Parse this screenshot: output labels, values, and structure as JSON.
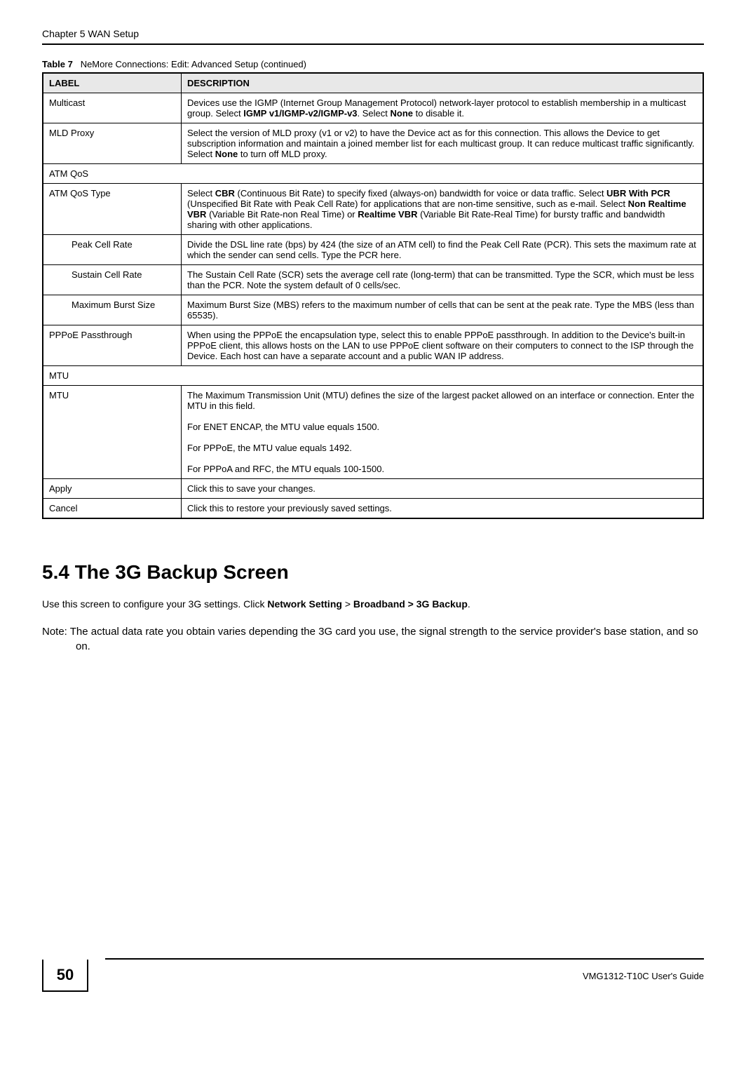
{
  "header": {
    "chapter": "Chapter 5 WAN Setup"
  },
  "table": {
    "caption_prefix": "Table 7",
    "caption_rest": "NeMore Connections: Edit: Advanced Setup (continued)",
    "head_label": "LABEL",
    "head_desc": "DESCRIPTION",
    "rows": {
      "multicast": {
        "label": "Multicast",
        "desc_pre": "Devices use the IGMP (Internet Group Management Protocol) network-layer protocol to establish membership in a multicast group. Select ",
        "b1": "IGMP v1/IGMP-v2/IGMP-v3",
        "desc_mid": ". Select ",
        "b2": "None",
        "desc_post": " to disable it."
      },
      "mld": {
        "label": "MLD Proxy",
        "desc_pre": "Select the version of MLD proxy (v1 or v2) to have the Device act as for this connection. This allows the Device to get subscription information and maintain a joined member list for each multicast group. It can reduce multicast traffic significantly. Select ",
        "b1": "None",
        "desc_post": " to turn off MLD proxy."
      },
      "atmqos_section": "ATM QoS",
      "atmqostype": {
        "label": "ATM QoS Type",
        "t1": "Select ",
        "b1": "CBR",
        "t2": " (Continuous Bit Rate) to specify fixed (always-on) bandwidth for voice or data traffic. Select ",
        "b2": "UBR With PCR",
        "t3": " (Unspecified Bit Rate with Peak Cell Rate) for applications that are non-time sensitive, such as e-mail. Select ",
        "b3": "Non Realtime VBR",
        "t4": " (Variable Bit Rate-non Real Time) or ",
        "b4": "Realtime VBR",
        "t5": " (Variable Bit Rate-Real Time) for bursty traffic and bandwidth sharing with other applications."
      },
      "pcr": {
        "label": "Peak Cell Rate",
        "desc": "Divide the DSL line rate (bps) by 424 (the size of an ATM cell) to find the Peak Cell Rate (PCR). This sets the maximum rate at which the sender can send cells. Type the PCR here."
      },
      "scr": {
        "label": "Sustain Cell Rate",
        "desc": "The Sustain Cell Rate (SCR) sets the average cell rate (long-term) that can be transmitted. Type the SCR, which must be less than the PCR. Note the system default of 0 cells/sec."
      },
      "mbs": {
        "label": "Maximum Burst Size",
        "desc": "Maximum Burst Size (MBS) refers to the maximum number of cells that can be sent at the peak rate. Type the MBS (less than 65535)."
      },
      "pppoe": {
        "label": "PPPoE Passthrough",
        "desc": "When using the PPPoE the encapsulation type, select this to enable PPPoE passthrough. In addition to the Device's built-in PPPoE client, this allows hosts on the LAN to use PPPoE client software on their computers to connect to the ISP through the Device. Each host can have a separate account and a public WAN IP address."
      },
      "mtu_section": "MTU",
      "mtu": {
        "label": "MTU",
        "p1": "The Maximum Transmission Unit (MTU) defines the size of the largest packet allowed on an interface or connection. Enter the MTU in this field.",
        "p2": "For ENET ENCAP, the MTU value equals 1500.",
        "p3": "For PPPoE, the MTU value equals 1492.",
        "p4": "For PPPoA and RFC, the MTU equals 100-1500."
      },
      "apply": {
        "label": "Apply",
        "desc": "Click this to save your changes."
      },
      "cancel": {
        "label": "Cancel",
        "desc": "Click this to restore your previously saved settings."
      }
    }
  },
  "section": {
    "title": "5.4  The 3G Backup Screen",
    "body_pre": "Use this screen to configure your 3G settings. Click ",
    "b1": "Network Setting",
    "body_mid": " > ",
    "b2": "Broadband > 3G Backup",
    "body_post": ".",
    "note": "Note: The actual data rate you obtain varies depending the 3G card you use, the signal strength to the service provider's base station, and so on."
  },
  "footer": {
    "page": "50",
    "guide": "VMG1312-T10C User's Guide"
  }
}
